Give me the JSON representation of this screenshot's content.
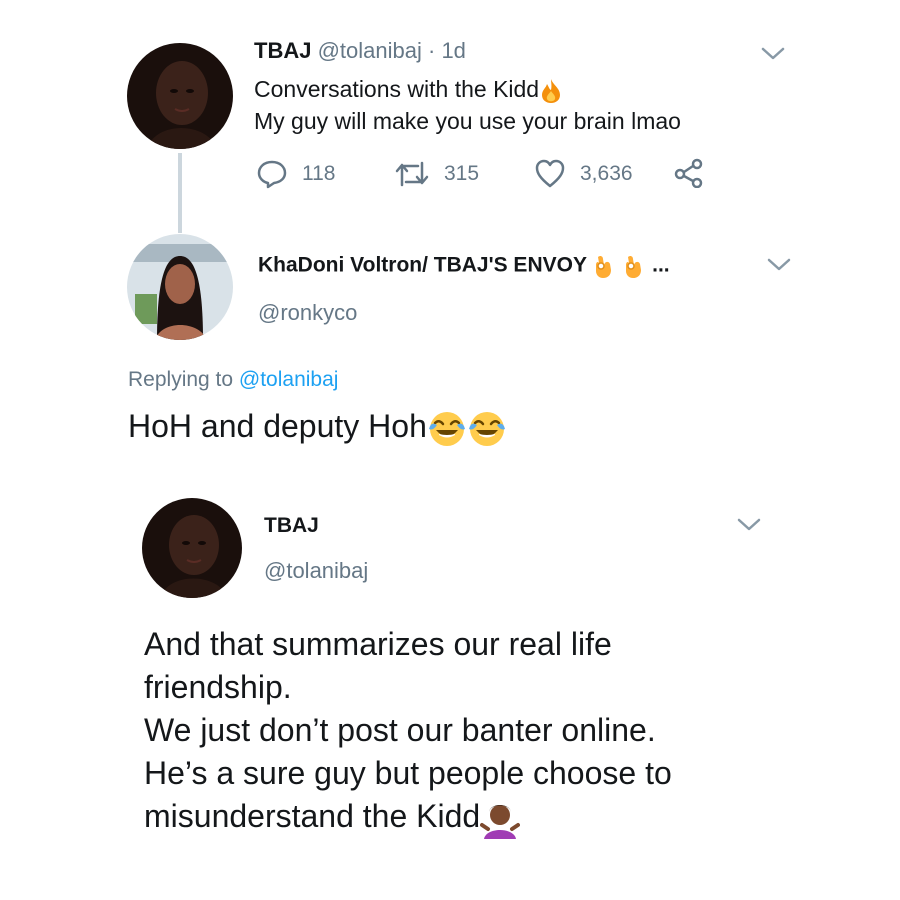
{
  "tweet1": {
    "name": "TBAJ",
    "handle": "@tolanibaj",
    "time": "· 1d",
    "line1": "Conversations with the Kidd",
    "line2": "My guy will make you use your brain lmao",
    "replies": "118",
    "retweets": "315",
    "likes": "3,636"
  },
  "tweet2": {
    "name": "KhaDoni Voltron/ TBAJ'S ENVOY",
    "name_suffix": "...",
    "handle": "@ronkyco",
    "replying_prefix": "Replying to ",
    "replying_to": "@tolanibaj",
    "text": "HoH and deputy Hoh"
  },
  "tweet3": {
    "name": "TBAJ",
    "handle": "@tolanibaj",
    "lines": [
      "And that summarizes our real life",
      "friendship.",
      "We just don’t post our banter online.",
      "He’s a sure guy but people choose to",
      "misunderstand the Kidd"
    ]
  },
  "colors": {
    "link": "#1da1f2",
    "muted": "#657786",
    "text": "#14171a"
  },
  "icons": [
    "chevron-down-icon",
    "reply-icon",
    "retweet-icon",
    "heart-icon",
    "share-icon",
    "fire-emoji",
    "ok-hand-emoji",
    "laughing-tears-emoji",
    "shrug-emoji"
  ]
}
